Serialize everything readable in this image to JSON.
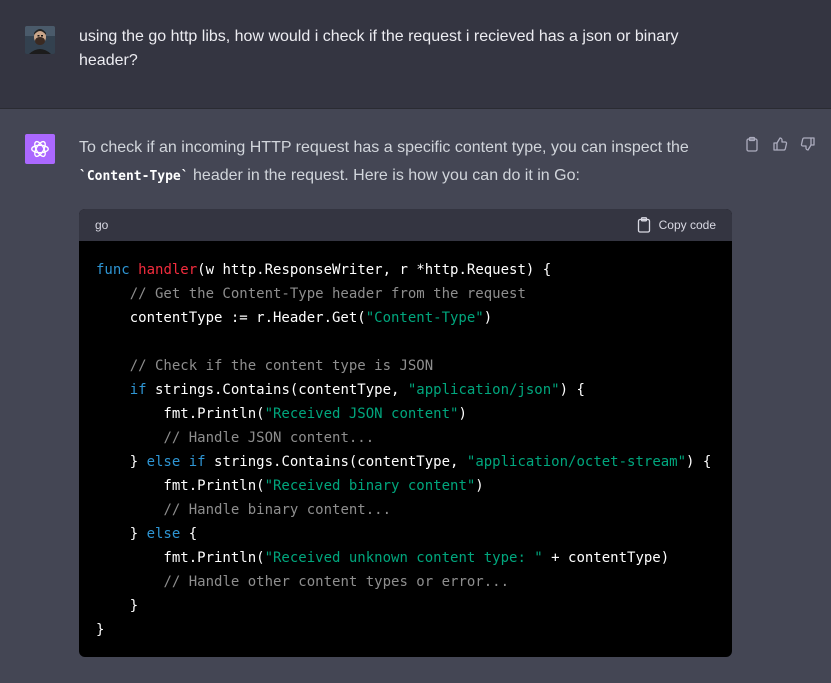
{
  "user_message": {
    "text": "using the go http libs, how would i check if the request i recieved has a json or binary header?"
  },
  "assistant_message": {
    "intro_part1": "To check if an incoming HTTP request has a specific content type, you can inspect the ",
    "intro_code": "`Content-Type`",
    "intro_part2": " header in the request. Here is how you can do it in Go:"
  },
  "actions": {
    "copy_icon": "clipboard-icon",
    "like_icon": "thumbs-up-icon",
    "dislike_icon": "thumbs-down-icon"
  },
  "code_block": {
    "language": "go",
    "copy_label": "Copy code",
    "lines": [
      [
        {
          "t": "func",
          "c": "kw"
        },
        {
          "t": " "
        },
        {
          "t": "handler",
          "c": "fn"
        },
        {
          "t": "(w http.ResponseWriter, r *http.Request) {"
        }
      ],
      [
        {
          "t": "    "
        },
        {
          "t": "// Get the Content-Type header from the request",
          "c": "cm"
        }
      ],
      [
        {
          "t": "    contentType := r.Header.Get("
        },
        {
          "t": "\"Content-Type\"",
          "c": "st"
        },
        {
          "t": ")"
        }
      ],
      [
        {
          "t": ""
        }
      ],
      [
        {
          "t": "    "
        },
        {
          "t": "// Check if the content type is JSON",
          "c": "cm"
        }
      ],
      [
        {
          "t": "    "
        },
        {
          "t": "if",
          "c": "kw"
        },
        {
          "t": " strings.Contains(contentType, "
        },
        {
          "t": "\"application/json\"",
          "c": "st"
        },
        {
          "t": ") {"
        }
      ],
      [
        {
          "t": "        fmt.Println("
        },
        {
          "t": "\"Received JSON content\"",
          "c": "st"
        },
        {
          "t": ")"
        }
      ],
      [
        {
          "t": "        "
        },
        {
          "t": "// Handle JSON content...",
          "c": "cm"
        }
      ],
      [
        {
          "t": "    } "
        },
        {
          "t": "else",
          "c": "kw"
        },
        {
          "t": " "
        },
        {
          "t": "if",
          "c": "kw"
        },
        {
          "t": " strings.Contains(contentType, "
        },
        {
          "t": "\"application/octet-stream\"",
          "c": "st"
        },
        {
          "t": ") {"
        }
      ],
      [
        {
          "t": "        fmt.Println("
        },
        {
          "t": "\"Received binary content\"",
          "c": "st"
        },
        {
          "t": ")"
        }
      ],
      [
        {
          "t": "        "
        },
        {
          "t": "// Handle binary content...",
          "c": "cm"
        }
      ],
      [
        {
          "t": "    } "
        },
        {
          "t": "else",
          "c": "kw"
        },
        {
          "t": " {"
        }
      ],
      [
        {
          "t": "        fmt.Println("
        },
        {
          "t": "\"Received unknown content type: \"",
          "c": "st"
        },
        {
          "t": " + contentType)"
        }
      ],
      [
        {
          "t": "        "
        },
        {
          "t": "// Handle other content types or error...",
          "c": "cm"
        }
      ],
      [
        {
          "t": "    }"
        }
      ],
      [
        {
          "t": "}"
        }
      ]
    ]
  },
  "colors": {
    "keyword": "#2e95d3",
    "function": "#f22c3d",
    "string": "#00a67d",
    "comment": "#8e8e8e",
    "avatar_bg": "#ab68ff"
  }
}
